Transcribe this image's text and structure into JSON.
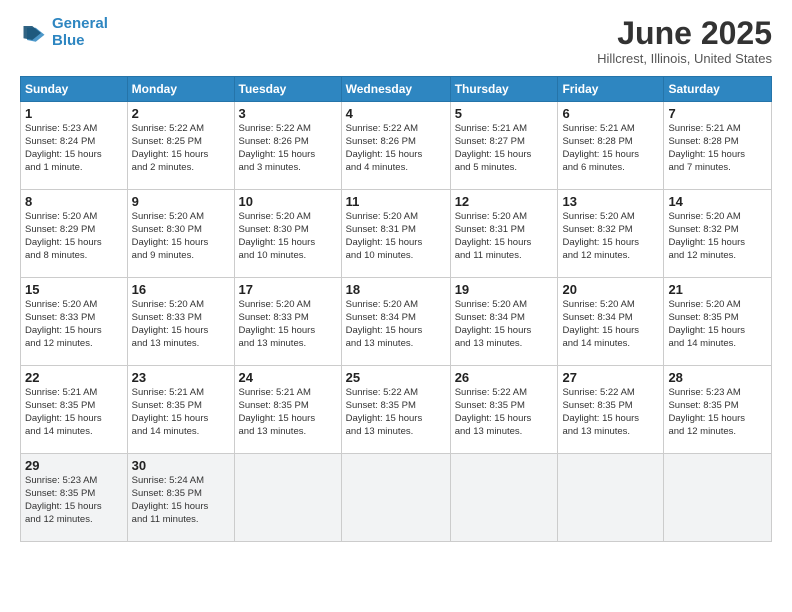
{
  "header": {
    "logo_line1": "General",
    "logo_line2": "Blue",
    "month_title": "June 2025",
    "location": "Hillcrest, Illinois, United States"
  },
  "days_of_week": [
    "Sunday",
    "Monday",
    "Tuesday",
    "Wednesday",
    "Thursday",
    "Friday",
    "Saturday"
  ],
  "weeks": [
    [
      {
        "num": "1",
        "info": "Sunrise: 5:23 AM\nSunset: 8:24 PM\nDaylight: 15 hours\nand 1 minute."
      },
      {
        "num": "2",
        "info": "Sunrise: 5:22 AM\nSunset: 8:25 PM\nDaylight: 15 hours\nand 2 minutes."
      },
      {
        "num": "3",
        "info": "Sunrise: 5:22 AM\nSunset: 8:26 PM\nDaylight: 15 hours\nand 3 minutes."
      },
      {
        "num": "4",
        "info": "Sunrise: 5:22 AM\nSunset: 8:26 PM\nDaylight: 15 hours\nand 4 minutes."
      },
      {
        "num": "5",
        "info": "Sunrise: 5:21 AM\nSunset: 8:27 PM\nDaylight: 15 hours\nand 5 minutes."
      },
      {
        "num": "6",
        "info": "Sunrise: 5:21 AM\nSunset: 8:28 PM\nDaylight: 15 hours\nand 6 minutes."
      },
      {
        "num": "7",
        "info": "Sunrise: 5:21 AM\nSunset: 8:28 PM\nDaylight: 15 hours\nand 7 minutes."
      }
    ],
    [
      {
        "num": "8",
        "info": "Sunrise: 5:20 AM\nSunset: 8:29 PM\nDaylight: 15 hours\nand 8 minutes."
      },
      {
        "num": "9",
        "info": "Sunrise: 5:20 AM\nSunset: 8:30 PM\nDaylight: 15 hours\nand 9 minutes."
      },
      {
        "num": "10",
        "info": "Sunrise: 5:20 AM\nSunset: 8:30 PM\nDaylight: 15 hours\nand 10 minutes."
      },
      {
        "num": "11",
        "info": "Sunrise: 5:20 AM\nSunset: 8:31 PM\nDaylight: 15 hours\nand 10 minutes."
      },
      {
        "num": "12",
        "info": "Sunrise: 5:20 AM\nSunset: 8:31 PM\nDaylight: 15 hours\nand 11 minutes."
      },
      {
        "num": "13",
        "info": "Sunrise: 5:20 AM\nSunset: 8:32 PM\nDaylight: 15 hours\nand 12 minutes."
      },
      {
        "num": "14",
        "info": "Sunrise: 5:20 AM\nSunset: 8:32 PM\nDaylight: 15 hours\nand 12 minutes."
      }
    ],
    [
      {
        "num": "15",
        "info": "Sunrise: 5:20 AM\nSunset: 8:33 PM\nDaylight: 15 hours\nand 12 minutes."
      },
      {
        "num": "16",
        "info": "Sunrise: 5:20 AM\nSunset: 8:33 PM\nDaylight: 15 hours\nand 13 minutes."
      },
      {
        "num": "17",
        "info": "Sunrise: 5:20 AM\nSunset: 8:33 PM\nDaylight: 15 hours\nand 13 minutes."
      },
      {
        "num": "18",
        "info": "Sunrise: 5:20 AM\nSunset: 8:34 PM\nDaylight: 15 hours\nand 13 minutes."
      },
      {
        "num": "19",
        "info": "Sunrise: 5:20 AM\nSunset: 8:34 PM\nDaylight: 15 hours\nand 13 minutes."
      },
      {
        "num": "20",
        "info": "Sunrise: 5:20 AM\nSunset: 8:34 PM\nDaylight: 15 hours\nand 14 minutes."
      },
      {
        "num": "21",
        "info": "Sunrise: 5:20 AM\nSunset: 8:35 PM\nDaylight: 15 hours\nand 14 minutes."
      }
    ],
    [
      {
        "num": "22",
        "info": "Sunrise: 5:21 AM\nSunset: 8:35 PM\nDaylight: 15 hours\nand 14 minutes."
      },
      {
        "num": "23",
        "info": "Sunrise: 5:21 AM\nSunset: 8:35 PM\nDaylight: 15 hours\nand 14 minutes."
      },
      {
        "num": "24",
        "info": "Sunrise: 5:21 AM\nSunset: 8:35 PM\nDaylight: 15 hours\nand 13 minutes."
      },
      {
        "num": "25",
        "info": "Sunrise: 5:22 AM\nSunset: 8:35 PM\nDaylight: 15 hours\nand 13 minutes."
      },
      {
        "num": "26",
        "info": "Sunrise: 5:22 AM\nSunset: 8:35 PM\nDaylight: 15 hours\nand 13 minutes."
      },
      {
        "num": "27",
        "info": "Sunrise: 5:22 AM\nSunset: 8:35 PM\nDaylight: 15 hours\nand 13 minutes."
      },
      {
        "num": "28",
        "info": "Sunrise: 5:23 AM\nSunset: 8:35 PM\nDaylight: 15 hours\nand 12 minutes."
      }
    ],
    [
      {
        "num": "29",
        "info": "Sunrise: 5:23 AM\nSunset: 8:35 PM\nDaylight: 15 hours\nand 12 minutes."
      },
      {
        "num": "30",
        "info": "Sunrise: 5:24 AM\nSunset: 8:35 PM\nDaylight: 15 hours\nand 11 minutes."
      },
      {
        "num": "",
        "info": ""
      },
      {
        "num": "",
        "info": ""
      },
      {
        "num": "",
        "info": ""
      },
      {
        "num": "",
        "info": ""
      },
      {
        "num": "",
        "info": ""
      }
    ]
  ]
}
